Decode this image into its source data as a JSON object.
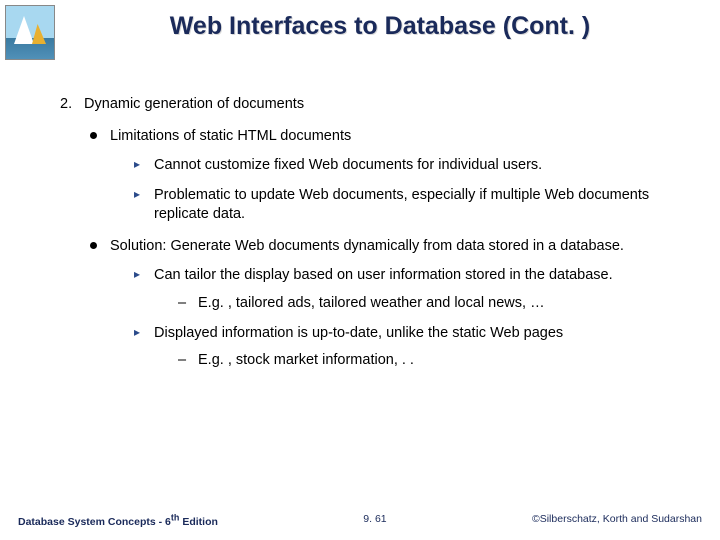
{
  "title": "Web Interfaces to Database (Cont. )",
  "list": {
    "number": "2.",
    "item": "Dynamic generation of documents",
    "b1_a": "Limitations of static HTML documents",
    "b2_a1": "Cannot customize fixed Web documents for individual users.",
    "b2_a2": "Problematic to update Web documents, especially if multiple Web documents replicate data.",
    "b1_b": "Solution: Generate Web documents dynamically from data stored in a database.",
    "b2_b1": "Can tailor the display based on user information stored in the database.",
    "b3_b1a": "E.g. , tailored ads, tailored weather and local news, …",
    "b2_b2": "Displayed information is up-to-date, unlike the static Web pages",
    "b3_b2a": "E.g. , stock market information, . ."
  },
  "footer": {
    "left_a": "Database System Concepts - 6",
    "left_sup": "th",
    "left_b": " Edition",
    "center": "9. 61",
    "right": "©Silberschatz, Korth and Sudarshan"
  }
}
